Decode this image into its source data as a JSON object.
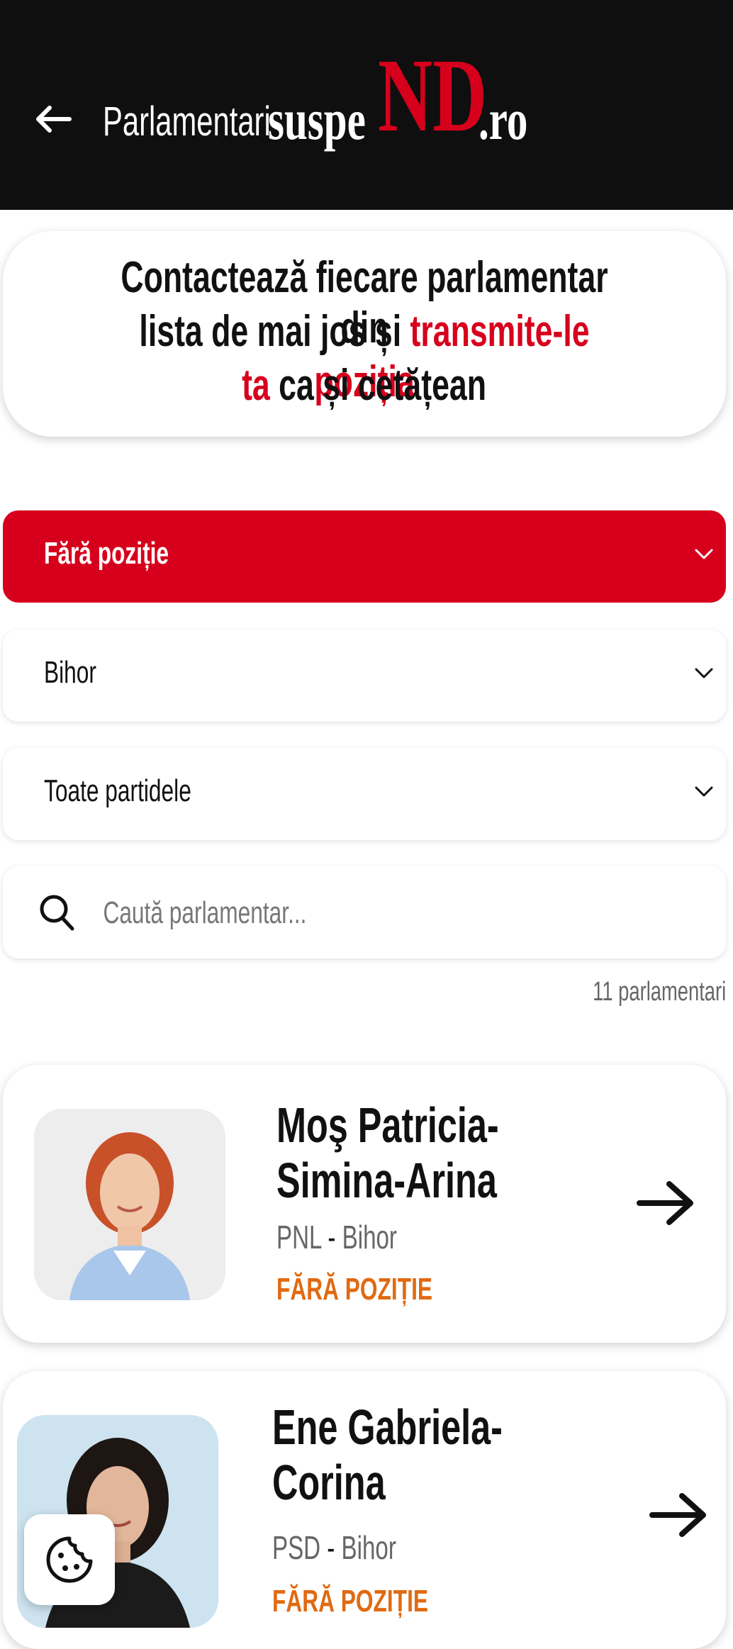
{
  "header": {
    "back_icon": "arrow-left-icon",
    "logo_part1": "Parlamentari",
    "logo_part2": "suspe",
    "logo_part3": "ND",
    "logo_part4": ".ro"
  },
  "intro": {
    "line1": "Contactează fiecare parlamentar din",
    "line2_plain": "lista de mai jos și ",
    "line2_red": "transmite-le poziția",
    "line3_red": "ta",
    "line3_plain": " ca și cetățean"
  },
  "filters": {
    "position": "Fără poziție",
    "county": "Bihor",
    "party": "Toate partidele",
    "search_placeholder": "Caută parlamentar..."
  },
  "result_count": "11 parlamentari",
  "cards": [
    {
      "name_line1": "Moş Patricia-",
      "name_line2": "Simina-Arina",
      "party": "PNL",
      "separator": "-",
      "county": "Bihor",
      "status": "FĂRĂ POZIȚIE"
    },
    {
      "name_line1": "Ene Gabriela-",
      "name_line2": "Corina",
      "party": "PSD",
      "separator": "-",
      "county": "Bihor",
      "status": "FĂRĂ POZIȚIE"
    }
  ],
  "colors": {
    "brand_red": "#d6001c",
    "header_bg": "#0f0f0f",
    "status_orange": "#e06a12"
  },
  "icons": {
    "cookie": "cookie-icon",
    "search": "search-icon",
    "chevron": "chevron-down-icon",
    "arrow": "arrow-right-icon"
  }
}
